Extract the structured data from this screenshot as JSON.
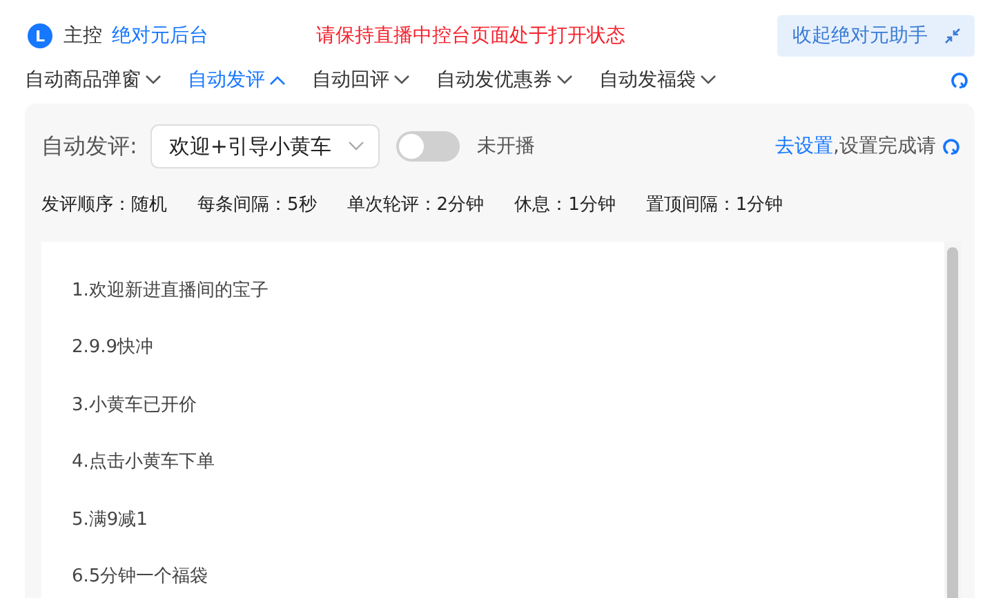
{
  "header": {
    "logo": "L",
    "title": "主控",
    "link": "绝对元后台",
    "notice": "请保持直播中控台页面处于打开状态",
    "collapse_button": "收起绝对元助手"
  },
  "tabs": [
    {
      "label": "自动商品弹窗",
      "selected": false
    },
    {
      "label": "自动发评",
      "selected": true
    },
    {
      "label": "自动回评",
      "selected": false
    },
    {
      "label": "自动发优惠券",
      "selected": false
    },
    {
      "label": "自动发福袋",
      "selected": false
    }
  ],
  "panel": {
    "label": "自动发评:",
    "dropdown": {
      "value": "欢迎+引导小黄车"
    },
    "toggle": {
      "on": false,
      "label": "未开播"
    },
    "hint_link": "去设置",
    "hint_text": ",设置完成请",
    "stats": [
      "发评顺序：随机",
      "每条间隔：5秒",
      "单次轮评：2分钟",
      "休息：1分钟",
      "置顶间隔：1分钟"
    ]
  },
  "comments": [
    "1.欢迎新进直播间的宝子",
    "2.9.9快冲",
    "3.小黄车已开价",
    "4.点击小黄车下单",
    "5.满9减1",
    "6.5分钟一个福袋"
  ]
}
